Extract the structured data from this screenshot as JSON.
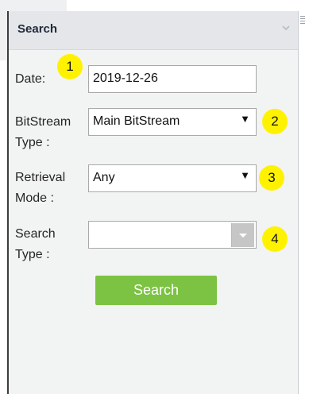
{
  "panel": {
    "title": "Search"
  },
  "fields": {
    "date": {
      "label": "Date:",
      "value": "2019-12-26"
    },
    "bitstream_type": {
      "label_line1": "BitStream",
      "label_line2": "Type :",
      "value": "Main BitStream"
    },
    "retrieval_mode": {
      "label_line1": "Retrieval",
      "label_line2": "Mode :",
      "value": "Any"
    },
    "search_type": {
      "label_line1": "Search",
      "label_line2": "Type :",
      "value": ""
    }
  },
  "search_button": {
    "label": "Search"
  },
  "badges": [
    "1",
    "2",
    "3",
    "4"
  ],
  "icons": {
    "panel_collapse": "chevron-down-icon",
    "select_arrow": "triangle-down-icon"
  },
  "colors": {
    "search_button": "#7cc243",
    "badge": "#fff200",
    "header": "#e4e6e9"
  }
}
